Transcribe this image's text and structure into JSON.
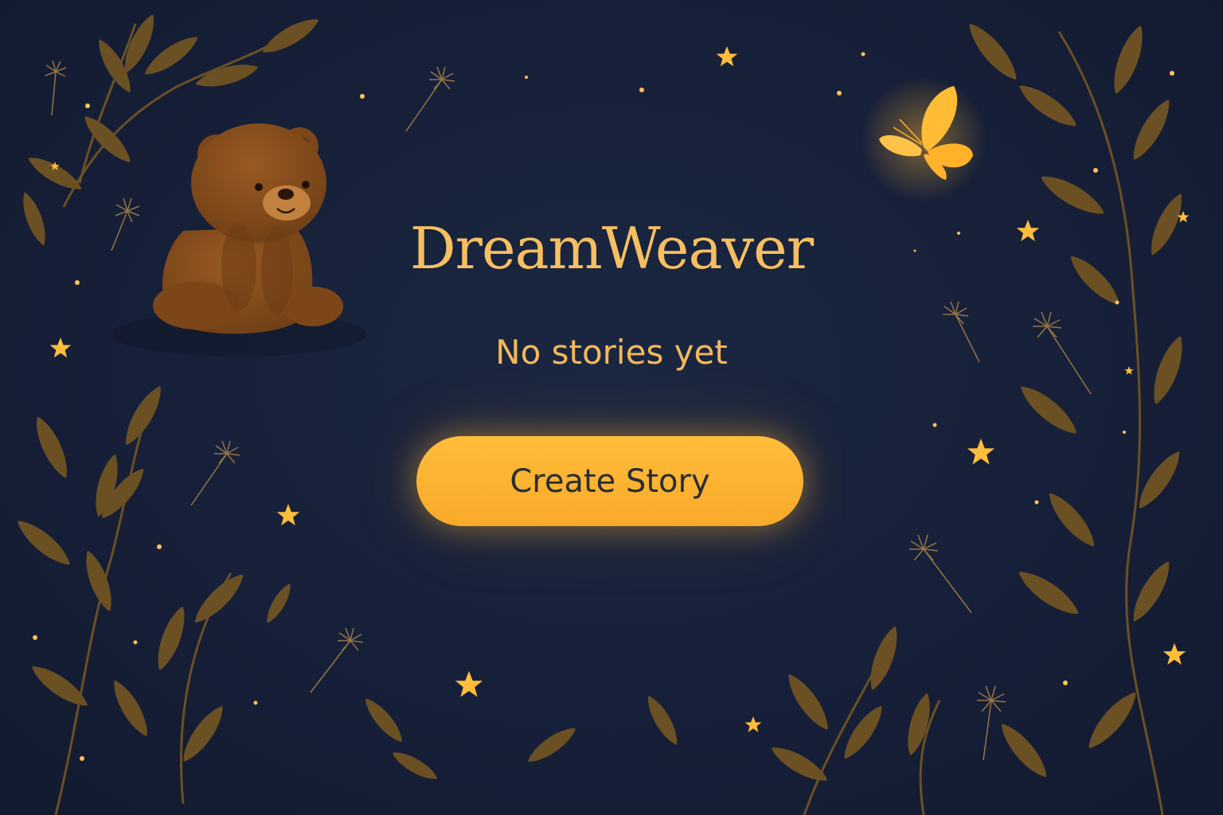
{
  "app": {
    "title": "DreamWeaver"
  },
  "empty_state": {
    "message": "No stories yet"
  },
  "actions": {
    "create_story_label": "Create Story"
  },
  "theme": {
    "background": "#17213a",
    "accent": "#f6bf62",
    "button_fill": "#ffb432",
    "button_text": "#2a2d36",
    "leaf": "#6b5024",
    "bear": "#8a4f1d"
  },
  "decorations": {
    "illustrations": [
      "bear-illustration",
      "butterfly-illustration",
      "leaf-vine",
      "dandelion-seed",
      "star-icon",
      "firefly-dot"
    ]
  }
}
